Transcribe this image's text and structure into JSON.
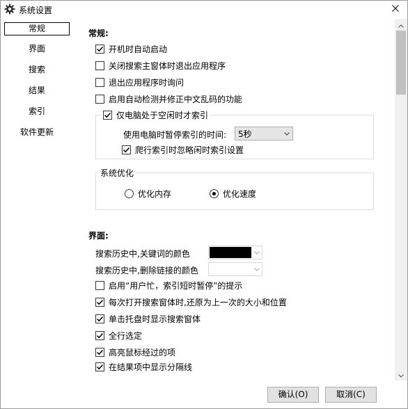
{
  "window": {
    "title": "系统设置",
    "close_label": "✕"
  },
  "nav": {
    "items": [
      {
        "label": "常规",
        "selected": true
      },
      {
        "label": "界面",
        "selected": false
      },
      {
        "label": "搜索",
        "selected": false
      },
      {
        "label": "结果",
        "selected": false
      },
      {
        "label": "索引",
        "selected": false
      },
      {
        "label": "软件更新",
        "selected": false
      }
    ]
  },
  "general": {
    "title": "常规:",
    "start_on_boot": {
      "label": "开机时自动启动",
      "checked": true
    },
    "exit_on_close": {
      "label": "关闭搜索主窗体时退出应用程序",
      "checked": false
    },
    "confirm_exit": {
      "label": "退出应用程序时询问",
      "checked": false
    },
    "fix_encoding": {
      "label": "启用自动检测并修正中文乱码的功能",
      "checked": false
    },
    "idle_index": {
      "label": "仅电脑处于空闲时才索引",
      "checked": true
    },
    "pause_label": "使用电脑时暂停索引的时间:",
    "pause_value": "5秒",
    "ignore_idle": {
      "label": "爬行索引时忽略闲时索引设置",
      "checked": true
    },
    "optimize": {
      "label": "系统优化",
      "memory": {
        "label": "优化内存",
        "selected": false
      },
      "speed": {
        "label": "优化速度",
        "selected": true
      }
    }
  },
  "ui": {
    "title": "界面:",
    "keyword_color_label": "搜索历史中,关键词的颜色",
    "keyword_color": "#000000",
    "deleted_link_color_label": "搜索历史中,删除链接的颜色",
    "deleted_link_color": "#ffffff",
    "busy_hint": {
      "label": "启用“用户忙，索引短时暂停”的提示",
      "checked": false
    },
    "restore_size": {
      "label": "每次打开搜索窗体时,还原为上一次的大小和位置",
      "checked": true
    },
    "tray_click": {
      "label": "单击托盘时显示搜索窗体",
      "checked": true
    },
    "full_row": {
      "label": "全行选定",
      "checked": true
    },
    "hover_highlight": {
      "label": "高亮鼠标经过的项",
      "checked": true
    },
    "separator": {
      "label": "在结果项中显示分隔线",
      "checked": true
    }
  },
  "footer": {
    "ok_label": "确认(O)",
    "cancel_label": "取消(C)"
  }
}
